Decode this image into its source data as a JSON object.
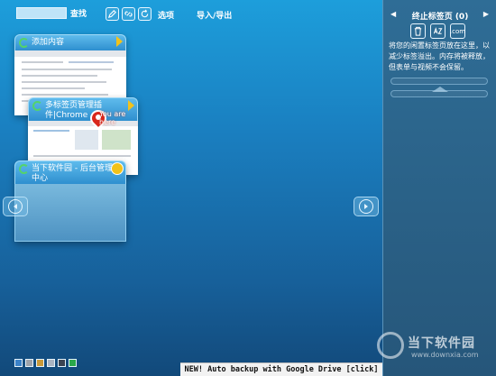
{
  "toolbar": {
    "search_label": "查找",
    "options_label": "选项",
    "import_export_label": "导入/导出",
    "icons": [
      "edit-icon",
      "link-icon",
      "refresh-icon"
    ]
  },
  "cards": [
    {
      "title": "添加内容"
    },
    {
      "title_line1": "多标签页管理插",
      "title_line2": "件|Chrome",
      "pin_text": "You are here"
    },
    {
      "title_line1": "当下软件园 - 后台管理",
      "title_line2": "中心"
    }
  ],
  "right_panel": {
    "title": "终止标签页 (0)",
    "arrow_left": "◀",
    "arrow_right": "▶",
    "description": "将您的闲置标签页放在这里，以减少标签溢出。内存将被释放，但表单与视频不会保留。",
    "icons": [
      "trash-icon",
      "sort-az-icon",
      "com-icon"
    ],
    "com_label": ".com"
  },
  "watermark": {
    "text": "当下软件园",
    "sub": "www.downxia.com"
  },
  "theme_swatches": [
    "#3b82c8",
    "#9ca3ab",
    "#c99a3a",
    "#a9b4c2",
    "#3b4452",
    "#2aa84a"
  ],
  "bottom_bar": {
    "text": "NEW! Auto backup with Google Drive [click]"
  }
}
